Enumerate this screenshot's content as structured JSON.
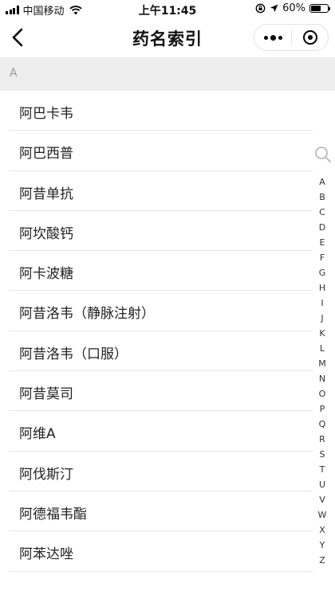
{
  "status_bar": {
    "carrier": "中国移动",
    "time": "上午11:45",
    "battery": "60%",
    "battery_level": 0.6,
    "icons": [
      "signal-icon",
      "wifi-icon",
      "rotation-lock-icon",
      "location-icon",
      "battery-icon"
    ]
  },
  "nav": {
    "title": "药名索引",
    "back_icon": "chevron-left-icon",
    "more_icon": "more-dots-icon",
    "close_icon": "target-close-icon"
  },
  "section": {
    "letter": "A"
  },
  "drugs": [
    "阿巴卡韦",
    "阿巴西普",
    "阿昔单抗",
    "阿坎酸钙",
    "阿卡波糖",
    "阿昔洛韦（静脉注射）",
    "阿昔洛韦（口服）",
    "阿昔莫司",
    "阿维A",
    "阿伐斯汀",
    "阿德福韦酯",
    "阿苯达唑"
  ],
  "index": {
    "search_icon": "search-icon",
    "letters": [
      "A",
      "B",
      "C",
      "D",
      "E",
      "F",
      "G",
      "H",
      "I",
      "J",
      "K",
      "L",
      "M",
      "N",
      "O",
      "P",
      "Q",
      "R",
      "S",
      "T",
      "U",
      "V",
      "W",
      "X",
      "Y",
      "Z"
    ]
  }
}
